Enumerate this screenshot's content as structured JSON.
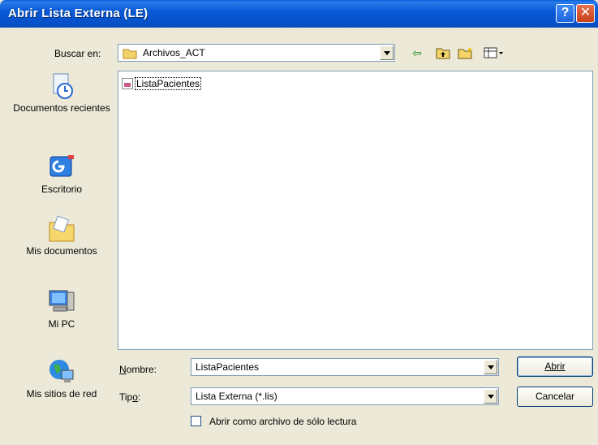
{
  "window": {
    "title": "Abrir Lista Externa (LE)",
    "help_glyph": "?",
    "close_glyph": "✕"
  },
  "lookin": {
    "label": "Buscar en:",
    "value": "Archivos_ACT"
  },
  "places": [
    {
      "label": "Documentos recientes",
      "icon": "recent-documents-icon"
    },
    {
      "label": "Escritorio",
      "icon": "desktop-icon"
    },
    {
      "label": "Mis documentos",
      "icon": "my-documents-icon"
    },
    {
      "label": "Mi PC",
      "icon": "my-computer-icon"
    },
    {
      "label": "Mis sitios de red",
      "icon": "network-places-icon"
    }
  ],
  "files": [
    {
      "name": "ListaPacientes"
    }
  ],
  "filename": {
    "label": "Nombre:",
    "value": "ListaPacientes"
  },
  "filetype": {
    "label": "Tipo:",
    "value": "Lista Externa (*.lis)"
  },
  "readonly": {
    "label": "Abrir como archivo de sólo lectura",
    "checked": false
  },
  "buttons": {
    "open": "Abrir",
    "cancel": "Cancelar"
  },
  "colors": {
    "titlebar": "#0859d6",
    "dialog_bg": "#ece9d8",
    "close_btn": "#c8421a"
  }
}
